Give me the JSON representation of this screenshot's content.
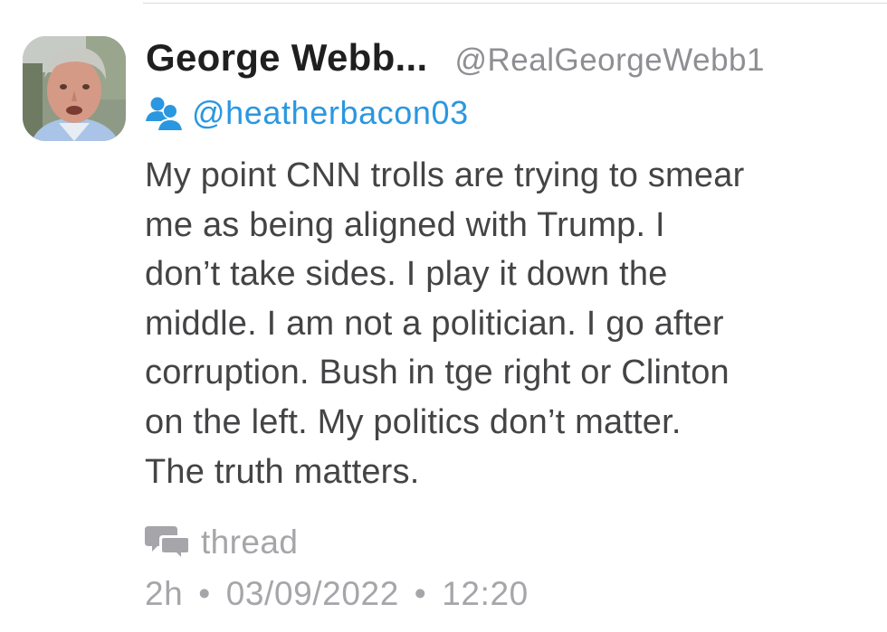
{
  "tweet": {
    "author": {
      "display_name": "George Webb...",
      "handle": "@RealGeorgeWebb1"
    },
    "reply_to": {
      "icon": "reply-users-icon",
      "handle": "@heatherbacon03"
    },
    "body_lines": [
      "My point CNN trolls are trying to smear",
      "me as being aligned with Trump. I",
      "don’t take sides. I play it down the",
      "middle. I am not a politician. I go after",
      "corruption. Bush in tge right or Clinton",
      "on the left. My politics don’t matter.",
      "The truth matters."
    ],
    "thread": {
      "icon": "thread-bubbles-icon",
      "label": "thread"
    },
    "meta": {
      "age": "2h",
      "separator": "•",
      "date": "03/09/2022",
      "time": "12:20"
    }
  },
  "colors": {
    "name_text": "#1f1f1f",
    "handle_text": "#8e8e93",
    "link_blue": "#2a97e0",
    "body_text": "#444446",
    "muted_text": "#a6a6aa"
  }
}
